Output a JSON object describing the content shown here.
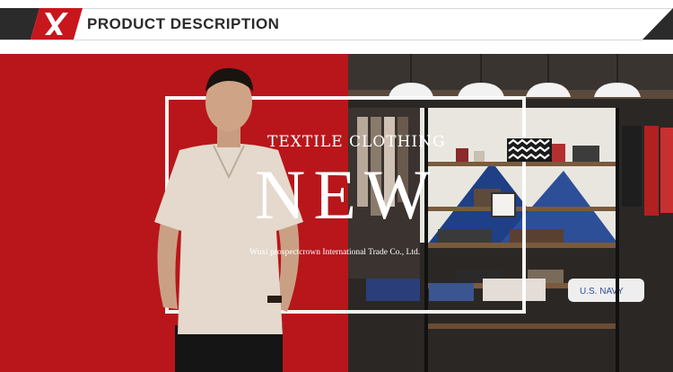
{
  "header": {
    "title": "PRODUCT DESCRIPTION",
    "accent_color": "#c8161d",
    "dark_color": "#2b2b2b"
  },
  "banner": {
    "subtitle": "TEXTILE CLOTHING",
    "headline": "NEW",
    "company": "Wuxi prospectcrown International Trade Co., Ltd.",
    "background_color": "#b8161b",
    "sign_text": "U.S. NAVY"
  }
}
